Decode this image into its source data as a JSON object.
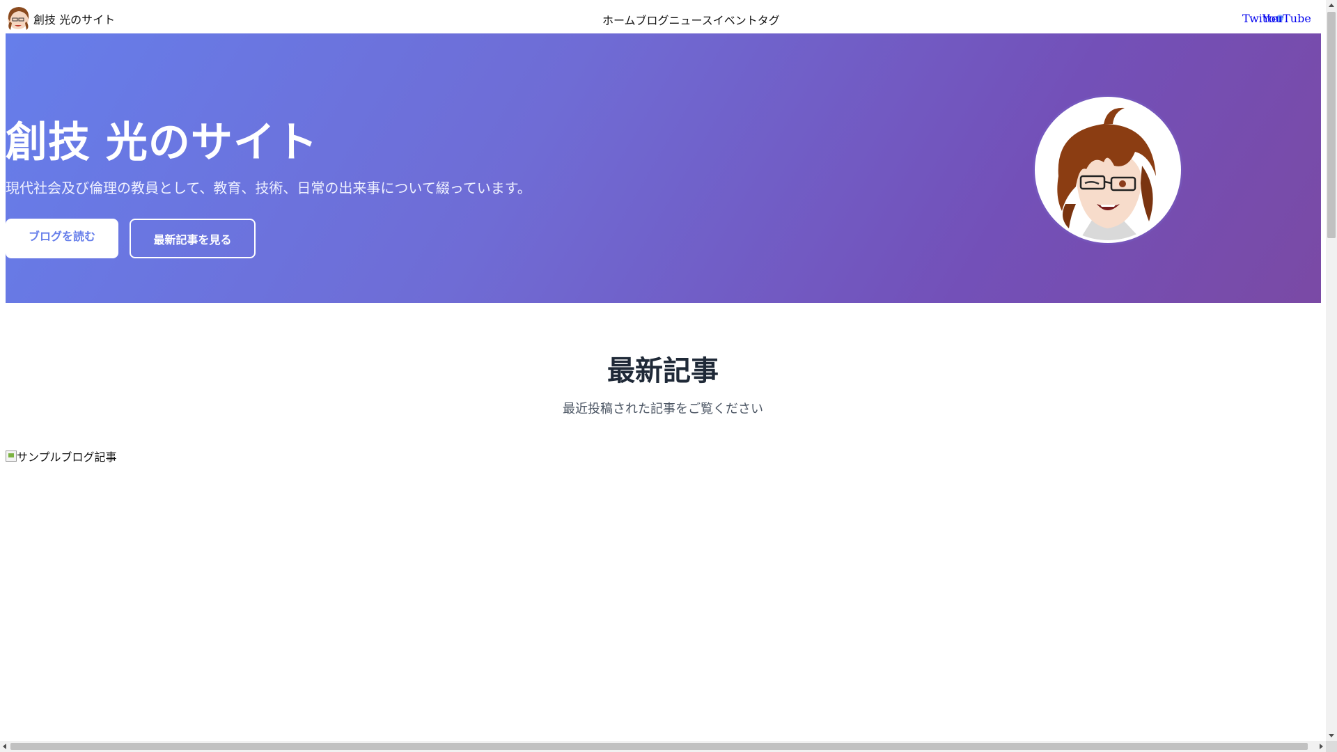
{
  "header": {
    "site_title": "創技 光のサイト",
    "nav": [
      "ホーム",
      "ブログ",
      "ニュース",
      "イベント",
      "タグ"
    ],
    "social": {
      "twitter": "Twitter",
      "youtube": "YouTube"
    }
  },
  "hero": {
    "title": "創技 光のサイト",
    "subtitle": "現代社会及び倫理の教員として、教育、技術、日常の出来事について綴っています。",
    "primary_button": "ブログを読む",
    "secondary_button": "最新記事を見る"
  },
  "latest": {
    "title": "最新記事",
    "subtitle": "最近投稿された記事をご覧ください",
    "post_image_alt": "サンプルブログ記事"
  },
  "colors": {
    "gradient_start": "#667eea",
    "gradient_end": "#7a4aa5",
    "link": "#0000ee",
    "primary_text": "#667eea"
  }
}
